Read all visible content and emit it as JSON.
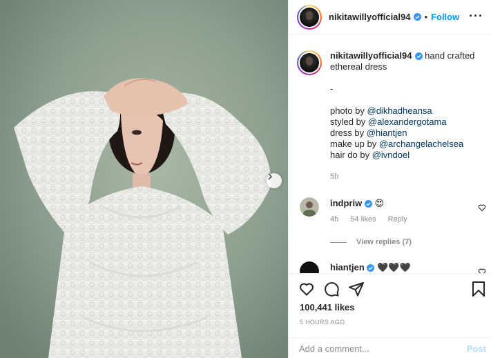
{
  "post": {
    "username": "nikitawillyofficial94",
    "follow_label": "Follow",
    "more_icon": "more-horizontal-icon",
    "dot": "•"
  },
  "caption": {
    "username": "nikitawillyofficial94",
    "text_line1": "hand crafted",
    "text_line2": "ethereal dress",
    "separator": "-",
    "credits": [
      {
        "label": "photo by ",
        "mention": "@dikhadheansa"
      },
      {
        "label": "styled by ",
        "mention": "@alexandergotama"
      },
      {
        "label": "dress by ",
        "mention": "@hiantjen"
      },
      {
        "label": "make up by ",
        "mention": "@archangelachelsea"
      },
      {
        "label": "hair do by ",
        "mention": "@ivndoel"
      }
    ],
    "time": "5h"
  },
  "comments": [
    {
      "username": "indpriw",
      "emoji": "😍",
      "time": "4h",
      "likes": "54 likes",
      "reply": "Reply",
      "view_replies": "View replies (7)"
    },
    {
      "username": "hiantjen",
      "emoji": "🖤🖤🖤"
    }
  ],
  "actions": {
    "likes": "100,441 likes",
    "posted_ago": "5 HOURS AGO",
    "add_comment_placeholder": "Add a comment...",
    "post_label": "Post"
  },
  "colors": {
    "accent": "#0095f6",
    "mention": "#00376b",
    "muted": "#8e8e8e",
    "post_disabled": "#b2dffc"
  }
}
